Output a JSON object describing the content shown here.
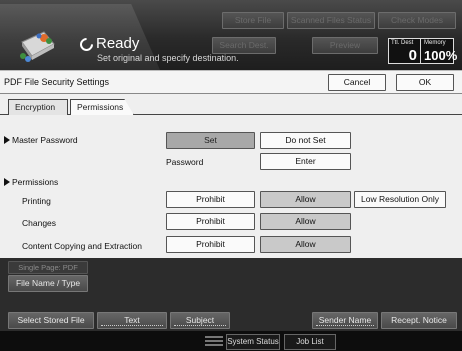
{
  "header": {
    "top_buttons": [
      "Store File",
      "Scanned Files Status",
      "Check Modes"
    ],
    "search_dest": "Search Dest.",
    "preview": "Preview",
    "status": "Ready",
    "hint": "Set original and specify destination.",
    "total_dest_label": "Ttl. Dest",
    "total_dest_value": "0",
    "memory_label": "Memory",
    "memory_value": "100%"
  },
  "dialog": {
    "title": "PDF File Security Settings",
    "cancel": "Cancel",
    "ok": "OK",
    "tabs": [
      {
        "label": "Encryption",
        "selected": false
      },
      {
        "label": "Permissions",
        "selected": true
      }
    ],
    "master_password": {
      "label": "Master Password",
      "set": "Set",
      "do_not_set": "Do not Set",
      "password_label": "Password",
      "enter": "Enter"
    },
    "permissions": {
      "label": "Permissions",
      "rows": [
        {
          "label": "Printing",
          "prohibit": "Prohibit",
          "allow": "Allow",
          "low_res": "Low Resolution Only"
        },
        {
          "label": "Changes",
          "prohibit": "Prohibit",
          "allow": "Allow"
        },
        {
          "label": "Content Copying and Extraction",
          "prohibit": "Prohibit",
          "allow": "Allow"
        }
      ]
    }
  },
  "bottom": {
    "single_page_pdf": "Single Page: PDF",
    "file_name_type": "File Name / Type",
    "select_stored_file": "Select Stored File",
    "text": "Text",
    "subject": "Subject",
    "sender_name": "Sender Name",
    "recept_notice": "Recept. Notice"
  },
  "statusbar": {
    "system_status": "System Status",
    "job_list": "Job List"
  }
}
